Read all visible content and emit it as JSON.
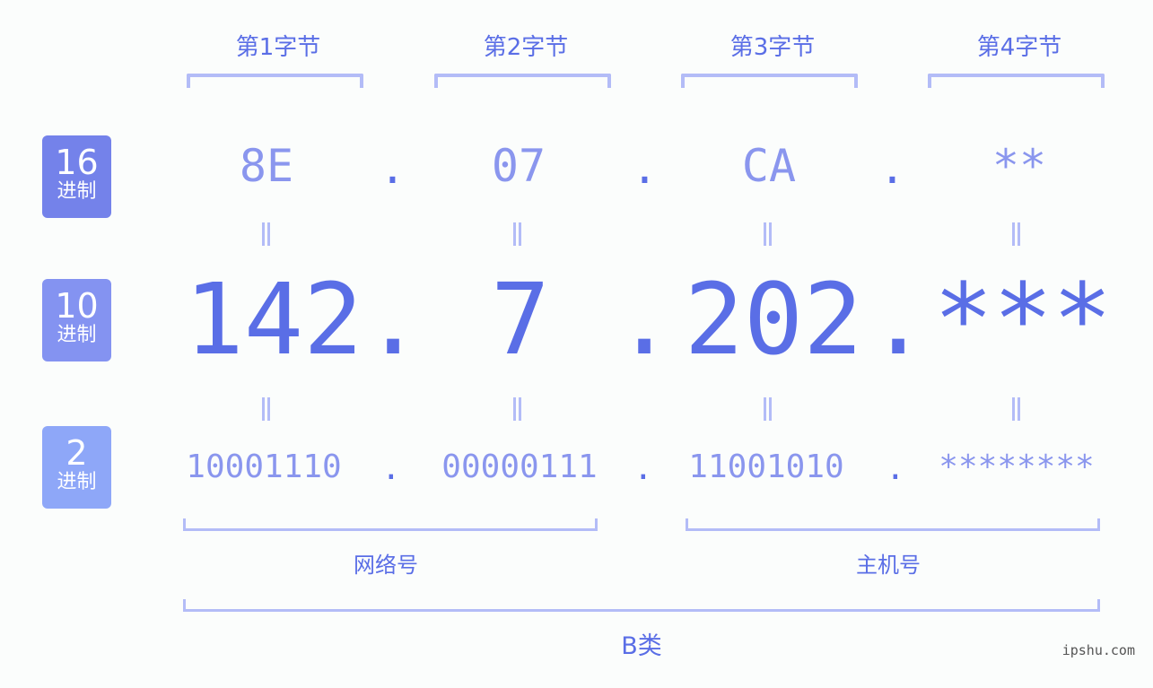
{
  "bytes": {
    "labels": [
      "第1字节",
      "第2字节",
      "第3字节",
      "第4字节"
    ]
  },
  "badges": [
    {
      "num": "16",
      "unit": "进制",
      "color": "#7482ea"
    },
    {
      "num": "10",
      "unit": "进制",
      "color": "#8493f1"
    },
    {
      "num": "2",
      "unit": "进制",
      "color": "#8ea7f8"
    }
  ],
  "hex": {
    "values": [
      "8E",
      "07",
      "CA",
      "**"
    ],
    "separator": "."
  },
  "decimal": {
    "values": [
      "142",
      "7",
      "202",
      "***"
    ],
    "separator": "."
  },
  "binary": {
    "values": [
      "10001110",
      "00000111",
      "11001010",
      "********"
    ],
    "separator": "."
  },
  "equals_sign": "=",
  "sections": {
    "network": "网络号",
    "host": "主机号",
    "class": "B类"
  },
  "colors": {
    "primary": "#5a6ee6",
    "light": "#8a96ee",
    "bracket": "#b3bcf7"
  },
  "watermark": "ipshu.com"
}
